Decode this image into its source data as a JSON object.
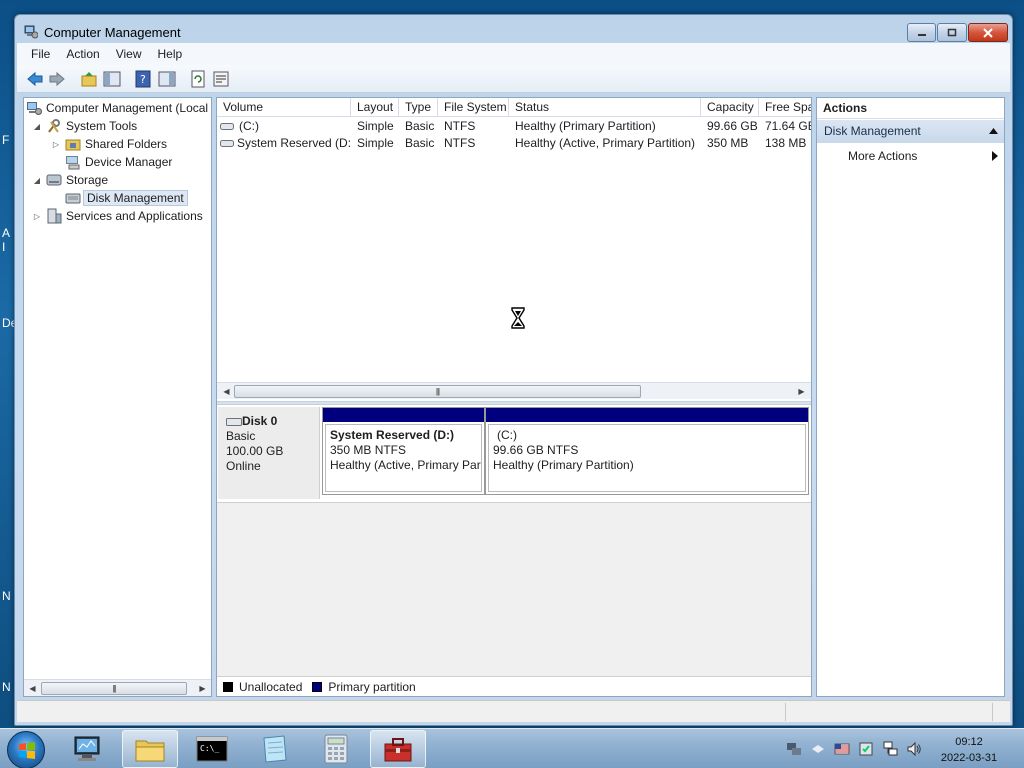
{
  "desktop_fragments": [
    "F",
    "A",
    "I",
    "De",
    "N",
    "N"
  ],
  "window": {
    "title": "Computer Management",
    "menu": [
      "File",
      "Action",
      "View",
      "Help"
    ]
  },
  "tree": {
    "items": [
      {
        "label": "Computer Management (Local",
        "arrow": "",
        "icon": "computer-management-icon"
      },
      {
        "label": "System Tools",
        "arrow": "◢",
        "icon": "system-tools-icon"
      },
      {
        "label": "Shared Folders",
        "arrow": "▷",
        "icon": "shared-folders-icon"
      },
      {
        "label": "Device Manager",
        "arrow": "",
        "icon": "device-manager-icon"
      },
      {
        "label": "Storage",
        "arrow": "◢",
        "icon": "storage-icon"
      },
      {
        "label": "Disk Management",
        "arrow": "",
        "icon": "disk-management-icon"
      },
      {
        "label": "Services and Applications",
        "arrow": "▷",
        "icon": "services-icon"
      }
    ]
  },
  "volumes": {
    "columns": [
      "Volume",
      "Layout",
      "Type",
      "File System",
      "Status",
      "Capacity",
      "Free Spac"
    ],
    "rows": [
      {
        "volume": "(C:)",
        "layout": "Simple",
        "type": "Basic",
        "fs": "NTFS",
        "status": "Healthy (Primary Partition)",
        "capacity": "99.66 GB",
        "free": "71.64 GB"
      },
      {
        "volume": "System Reserved (D:)",
        "layout": "Simple",
        "type": "Basic",
        "fs": "NTFS",
        "status": "Healthy (Active, Primary Partition)",
        "capacity": "350 MB",
        "free": "138 MB"
      }
    ]
  },
  "disk": {
    "name": "Disk 0",
    "type": "Basic",
    "size": "100.00 GB",
    "state": "Online",
    "partitions": [
      {
        "title": "System Reserved  (D:)",
        "size_fs": "350 MB NTFS",
        "status": "Healthy (Active, Primary Par"
      },
      {
        "title": "(C:)",
        "size_fs": "99.66 GB NTFS",
        "status": "Healthy (Primary Partition)"
      }
    ]
  },
  "legend": [
    {
      "label": "Unallocated",
      "color": "#000000"
    },
    {
      "label": "Primary partition",
      "color": "#00007f"
    }
  ],
  "actions": {
    "header": "Actions",
    "section": "Disk Management",
    "items": [
      "More Actions"
    ]
  },
  "taskbar": {
    "apps": [
      "computer-management-icon",
      "explorer-icon",
      "cmd-icon",
      "notepad-icon",
      "calculator-icon",
      "toolbox-icon"
    ],
    "time": "09:12",
    "date": "2022-03-31"
  },
  "colors": {
    "primary_partition": "#00007f",
    "unallocated": "#000000"
  }
}
